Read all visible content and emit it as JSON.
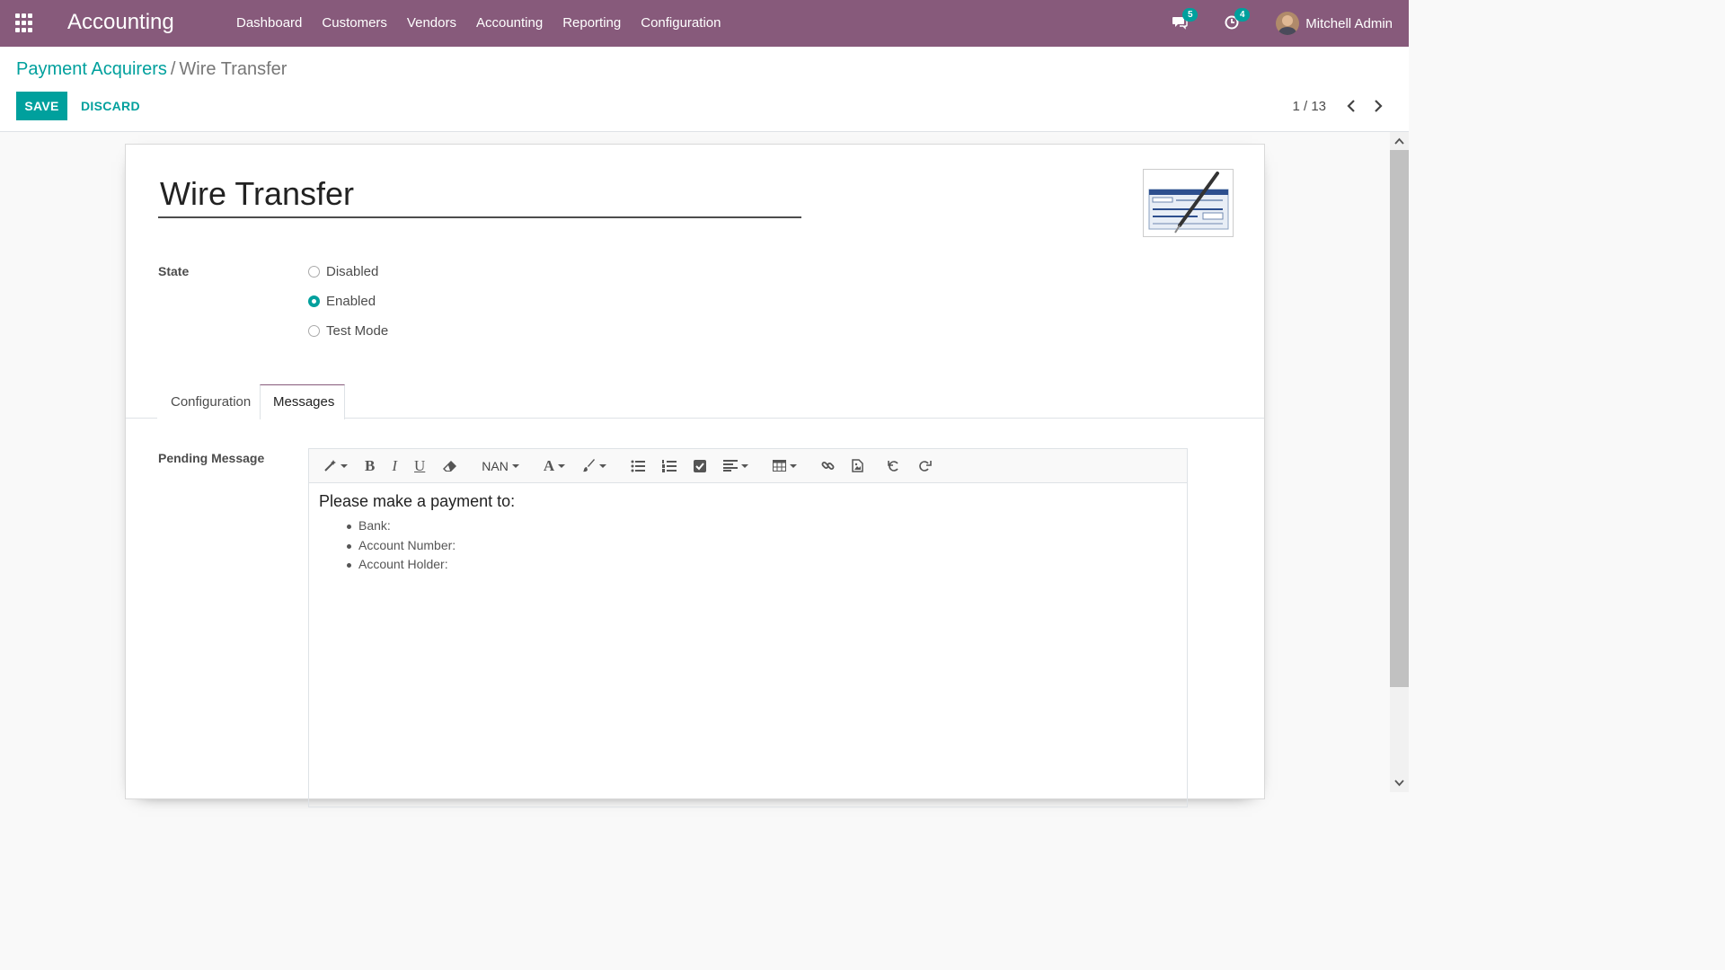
{
  "navbar": {
    "app_name": "Accounting",
    "menu": [
      "Dashboard",
      "Customers",
      "Vendors",
      "Accounting",
      "Reporting",
      "Configuration"
    ],
    "messages_count": "5",
    "activities_count": "4",
    "user_name": "Mitchell Admin"
  },
  "breadcrumb": {
    "parent": "Payment Acquirers",
    "separator": "/",
    "current": "Wire Transfer"
  },
  "buttons": {
    "save": "SAVE",
    "discard": "DISCARD"
  },
  "pager": {
    "value": "1 / 13"
  },
  "form": {
    "name": "Wire Transfer",
    "state_label": "State",
    "state_options": [
      "Disabled",
      "Enabled",
      "Test Mode"
    ],
    "state_selected": "Enabled",
    "tabs": [
      "Configuration",
      "Messages"
    ],
    "active_tab": "Messages",
    "pending_label": "Pending Message",
    "editor": {
      "font_size_label": "NAN",
      "heading": "Please make a payment to:",
      "items": [
        "Bank:",
        "Account Number:",
        "Account Holder:"
      ]
    }
  },
  "colors": {
    "navbar": "#875a7b",
    "primary": "#00a09d"
  }
}
